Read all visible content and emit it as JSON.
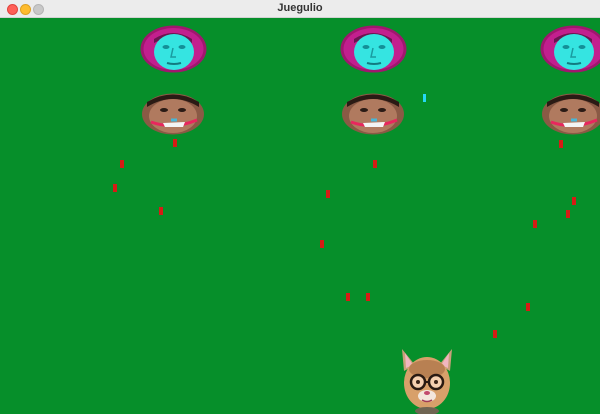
{
  "window": {
    "title": "Juegulio"
  },
  "colors": {
    "field": "#068f2a",
    "enemy_bullet": "#d61b15",
    "player_shot": "#25d8f3",
    "cyan_face": "#35e4e1",
    "magenta_rim": "#c21f8e"
  },
  "enemies_row1": [
    {
      "icon": "cyan-face-icon"
    },
    {
      "icon": "cyan-face-icon"
    },
    {
      "icon": "cyan-face-icon"
    }
  ],
  "enemies_row2": [
    {
      "icon": "grinning-face-icon"
    },
    {
      "icon": "grinning-face-icon"
    },
    {
      "icon": "grinning-face-icon"
    }
  ],
  "player": {
    "icon": "cat-eared-face-icon"
  }
}
